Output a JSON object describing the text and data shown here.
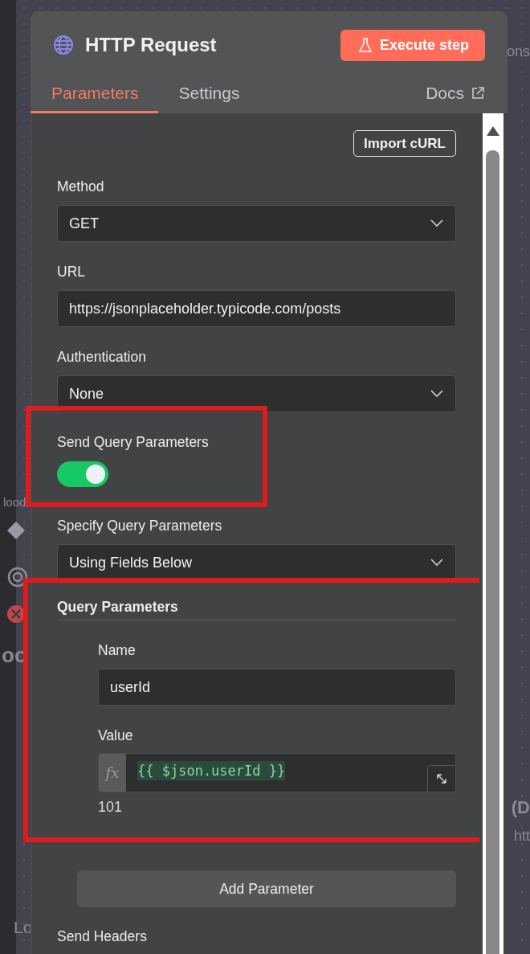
{
  "header": {
    "title": "HTTP Request",
    "execute_button": "Execute step"
  },
  "tabs": [
    {
      "label": "Parameters",
      "selected": true
    },
    {
      "label": "Settings",
      "selected": false
    }
  ],
  "docs_link": "Docs",
  "import_button": "Import cURL",
  "fields": [
    {
      "kind": "select",
      "label": "Method",
      "value": "GET",
      "highlighted": false
    },
    {
      "kind": "text",
      "label": "URL",
      "value": "https://jsonplaceholder.typicode.com/posts",
      "highlighted": false
    },
    {
      "kind": "select",
      "label": "Authentication",
      "value": "None",
      "highlighted": false
    },
    {
      "kind": "toggle",
      "label": "Send Query Parameters",
      "on": true,
      "highlighted": true
    },
    {
      "kind": "select",
      "label": "Specify Query Parameters",
      "value": "Using Fields Below",
      "highlighted": false
    }
  ],
  "query_parameters": {
    "title": "Query Parameters",
    "highlighted": true,
    "items": [
      {
        "name_label": "Name",
        "name": "userId",
        "value_label": "Value",
        "fx": "fx",
        "expression": "{{ $json.userId }}",
        "result": "101"
      }
    ],
    "add_button": "Add Parameter"
  },
  "next_field": {
    "label": "Send Headers"
  },
  "canvas_fragments": [
    "ons",
    "lood",
    "oo",
    "(D",
    "htt",
    "Lo"
  ]
}
